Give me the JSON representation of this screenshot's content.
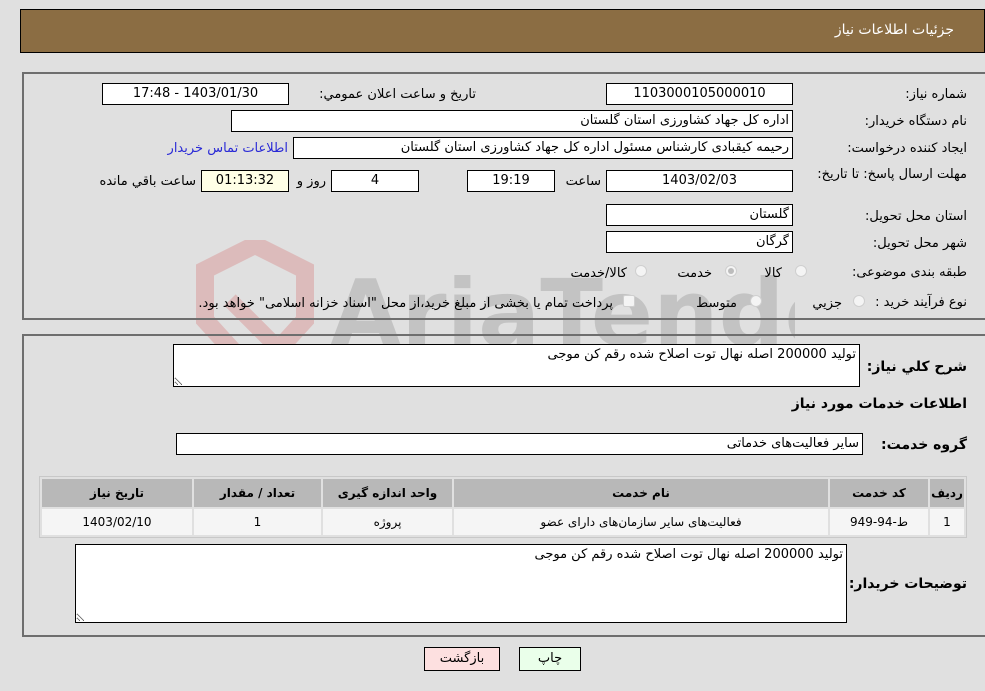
{
  "header": {
    "title": "جزئیات اطلاعات نیاز"
  },
  "watermark": {
    "text": "AriaTender.neT"
  },
  "details": {
    "need_number": {
      "label": "شماره نیاز:",
      "value": "1103000105000010"
    },
    "announce_datetime": {
      "label": "تاریخ و ساعت اعلان عمومي:",
      "value": "1403/01/30 - 17:48"
    },
    "buyer_org": {
      "label": "نام دستگاه خریدار:",
      "value": "اداره کل جهاد کشاورزی استان گلستان"
    },
    "requester": {
      "label": "ایجاد کننده درخواست:",
      "value": "رحیمه کیقبادی کارشناس مسئول اداره کل جهاد کشاورزی استان گلستان"
    },
    "buyer_contact_link": "اطلاعات تماس خریدار",
    "deadline": {
      "label": "مهلت ارسال پاسخ: تا تاریخ:",
      "date": "1403/02/03",
      "time_label": "ساعت",
      "time": "19:19",
      "days": "4",
      "days_label": "روز و",
      "remaining": "01:13:32",
      "remaining_label": "ساعت باقي مانده"
    },
    "province": {
      "label": "استان محل تحویل:",
      "value": "گلستان"
    },
    "city": {
      "label": "شهر محل تحویل:",
      "value": "گرگان"
    },
    "category": {
      "label": "طبقه بندی موضوعی:",
      "options": [
        "کالا",
        "خدمت",
        "کالا/خدمت"
      ],
      "selected": "خدمت"
    },
    "purchase_type": {
      "label": "نوع فرآیند خرید :",
      "options": [
        "جزیي",
        "متوسط"
      ],
      "checkbox_label": "پرداخت تمام یا بخشی از مبلغ خرید،از محل \"اسناد خزانه اسلامی\" خواهد بود."
    }
  },
  "description": {
    "label": "شرح کلي نياز:",
    "value": "تولید 200000 اصله نهال توت اصلاح شده رقم کن موجی"
  },
  "services_section": {
    "title": "اطلاعات خدمات مورد نیاز",
    "group_label": "گروه خدمت:",
    "group_value": "سایر فعالیت‌های خدماتی",
    "table": {
      "headers": [
        "ردیف",
        "کد خدمت",
        "نام خدمت",
        "واحد اندازه گیری",
        "تعداد / مقدار",
        "تاریخ نیاز"
      ],
      "rows": [
        [
          "1",
          "ط-94-949",
          "فعالیت‌های سایر سازمان‌های دارای عضو",
          "پروژه",
          "1",
          "1403/02/10"
        ]
      ]
    }
  },
  "buyer_notes": {
    "label": "توضیحات خریدار:",
    "value": "تولید 200000 اصله نهال توت اصلاح شده رقم کن موجی"
  },
  "buttons": {
    "print": "چاپ",
    "back": "بازگشت"
  }
}
